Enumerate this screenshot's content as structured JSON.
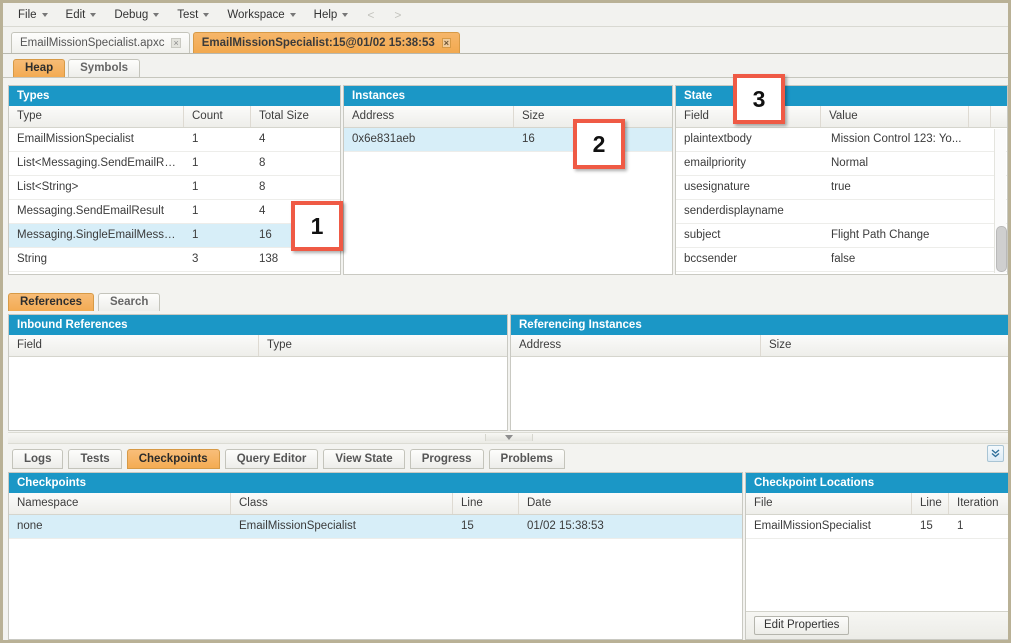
{
  "menubar": {
    "items": [
      {
        "label": "File",
        "has_caret": true
      },
      {
        "label": "Edit",
        "has_caret": true
      },
      {
        "label": "Debug",
        "has_caret": true
      },
      {
        "label": "Test",
        "has_caret": true
      },
      {
        "label": "Workspace",
        "has_caret": true
      },
      {
        "label": "Help",
        "has_caret": true
      }
    ],
    "back_label": "<",
    "forward_label": ">"
  },
  "file_tabs": [
    {
      "label": "EmailMissionSpecialist.apxc",
      "active": false,
      "close": "×"
    },
    {
      "label": "EmailMissionSpecialist:15@01/02 15:38:53",
      "active": true,
      "close": "×"
    }
  ],
  "sub_tabs": [
    {
      "label": "Heap",
      "active": true
    },
    {
      "label": "Symbols",
      "active": false
    }
  ],
  "types_panel": {
    "title": "Types",
    "columns": [
      "Type",
      "Count",
      "Total Size"
    ],
    "rows": [
      {
        "type": "EmailMissionSpecialist",
        "count": "1",
        "total_size": "4",
        "selected": false
      },
      {
        "type": "List<Messaging.SendEmailRes...",
        "count": "1",
        "total_size": "8",
        "selected": false
      },
      {
        "type": "List<String>",
        "count": "1",
        "total_size": "8",
        "selected": false
      },
      {
        "type": "Messaging.SendEmailResult",
        "count": "1",
        "total_size": "4",
        "selected": false
      },
      {
        "type": "Messaging.SingleEmailMessage",
        "count": "1",
        "total_size": "16",
        "selected": true
      },
      {
        "type": "String",
        "count": "3",
        "total_size": "138",
        "selected": false
      }
    ]
  },
  "instances_panel": {
    "title": "Instances",
    "columns": [
      "Address",
      "Size"
    ],
    "rows": [
      {
        "address": "0x6e831aeb",
        "size": "16",
        "selected": true
      }
    ]
  },
  "state_panel": {
    "title": "State",
    "columns": [
      "Field",
      "Value",
      "",
      ""
    ],
    "rows": [
      {
        "field": "plaintextbody",
        "value": "Mission Control 123: Yo..."
      },
      {
        "field": "emailpriority",
        "value": "Normal"
      },
      {
        "field": "usesignature",
        "value": "true"
      },
      {
        "field": "senderdisplayname",
        "value": ""
      },
      {
        "field": "subject",
        "value": "Flight Path Change"
      },
      {
        "field": "bccsender",
        "value": "false"
      }
    ]
  },
  "reference_tabs": [
    {
      "label": "References",
      "active": true
    },
    {
      "label": "Search",
      "active": false
    }
  ],
  "inbound_panel": {
    "title": "Inbound References",
    "columns": [
      "Field",
      "Type"
    ],
    "rows": []
  },
  "referencing_panel": {
    "title": "Referencing Instances",
    "columns": [
      "Address",
      "Size"
    ],
    "rows": []
  },
  "bottom_tabs": [
    {
      "label": "Logs",
      "active": false
    },
    {
      "label": "Tests",
      "active": false
    },
    {
      "label": "Checkpoints",
      "active": true
    },
    {
      "label": "Query Editor",
      "active": false
    },
    {
      "label": "View State",
      "active": false
    },
    {
      "label": "Progress",
      "active": false
    },
    {
      "label": "Problems",
      "active": false
    }
  ],
  "collapse_icon": "»",
  "checkpoints_panel": {
    "title": "Checkpoints",
    "columns": [
      "Namespace",
      "Class",
      "Line",
      "Date"
    ],
    "rows": [
      {
        "namespace": "none",
        "class": "EmailMissionSpecialist",
        "line": "15",
        "date": "01/02 15:38:53",
        "selected": true
      }
    ]
  },
  "checkpoint_locations_panel": {
    "title": "Checkpoint Locations",
    "columns": [
      "File",
      "Line",
      "Iteration"
    ],
    "rows": [
      {
        "file": "EmailMissionSpecialist",
        "line": "15",
        "iteration": "1"
      }
    ],
    "edit_properties_label": "Edit Properties"
  },
  "callouts": [
    {
      "number": "1"
    },
    {
      "number": "2"
    },
    {
      "number": "3"
    }
  ],
  "colors": {
    "panel_header": "#1b97c6",
    "active_tab": "#f3ab52",
    "row_selected": "#d7eef8",
    "callout_border": "#ef5a45"
  }
}
